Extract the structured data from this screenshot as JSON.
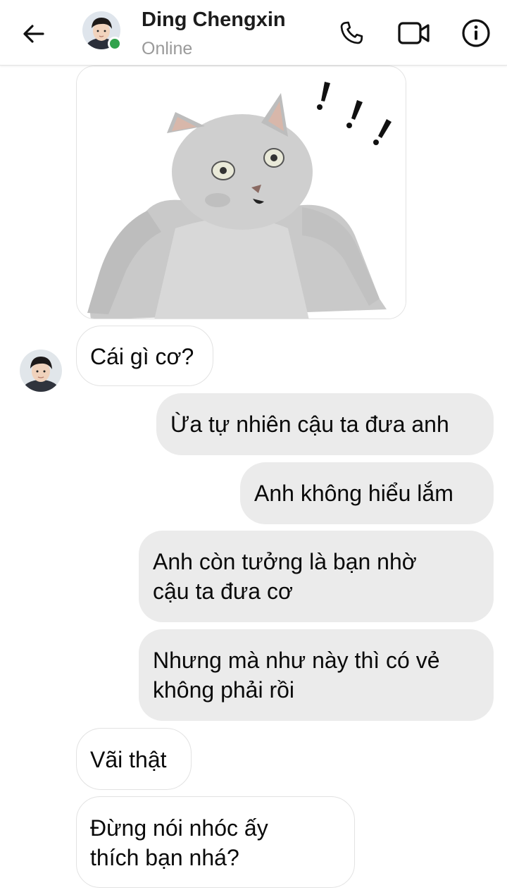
{
  "header": {
    "contact_name": "Ding Chengxin",
    "status": "Online",
    "back_icon": "arrow-left-icon",
    "call_icon": "phone-icon",
    "video_icon": "video-camera-icon",
    "info_icon": "info-icon"
  },
  "colors": {
    "online": "#31a24c",
    "outgoing_bubble": "#ebebeb",
    "incoming_bubble": "#ffffff"
  },
  "messages": [
    {
      "direction": "incoming",
      "type": "sticker",
      "content": "cat-sticker"
    },
    {
      "direction": "incoming",
      "text": "Cái gì cơ?"
    },
    {
      "direction": "outgoing",
      "text": "Ừa tự nhiên cậu ta đưa anh"
    },
    {
      "direction": "outgoing",
      "text": "Anh không hiểu lắm"
    },
    {
      "direction": "outgoing",
      "text_lines": [
        "Anh còn tưởng là bạn nhờ",
        "cậu ta đưa cơ"
      ]
    },
    {
      "direction": "outgoing",
      "text_lines": [
        "Nhưng mà như này thì có vẻ",
        "không phải rồi"
      ]
    },
    {
      "direction": "incoming",
      "text": "Vãi thật"
    },
    {
      "direction": "incoming",
      "text_lines": [
        "Đừng nói nhóc ấy",
        "thích bạn nhá?"
      ]
    }
  ]
}
